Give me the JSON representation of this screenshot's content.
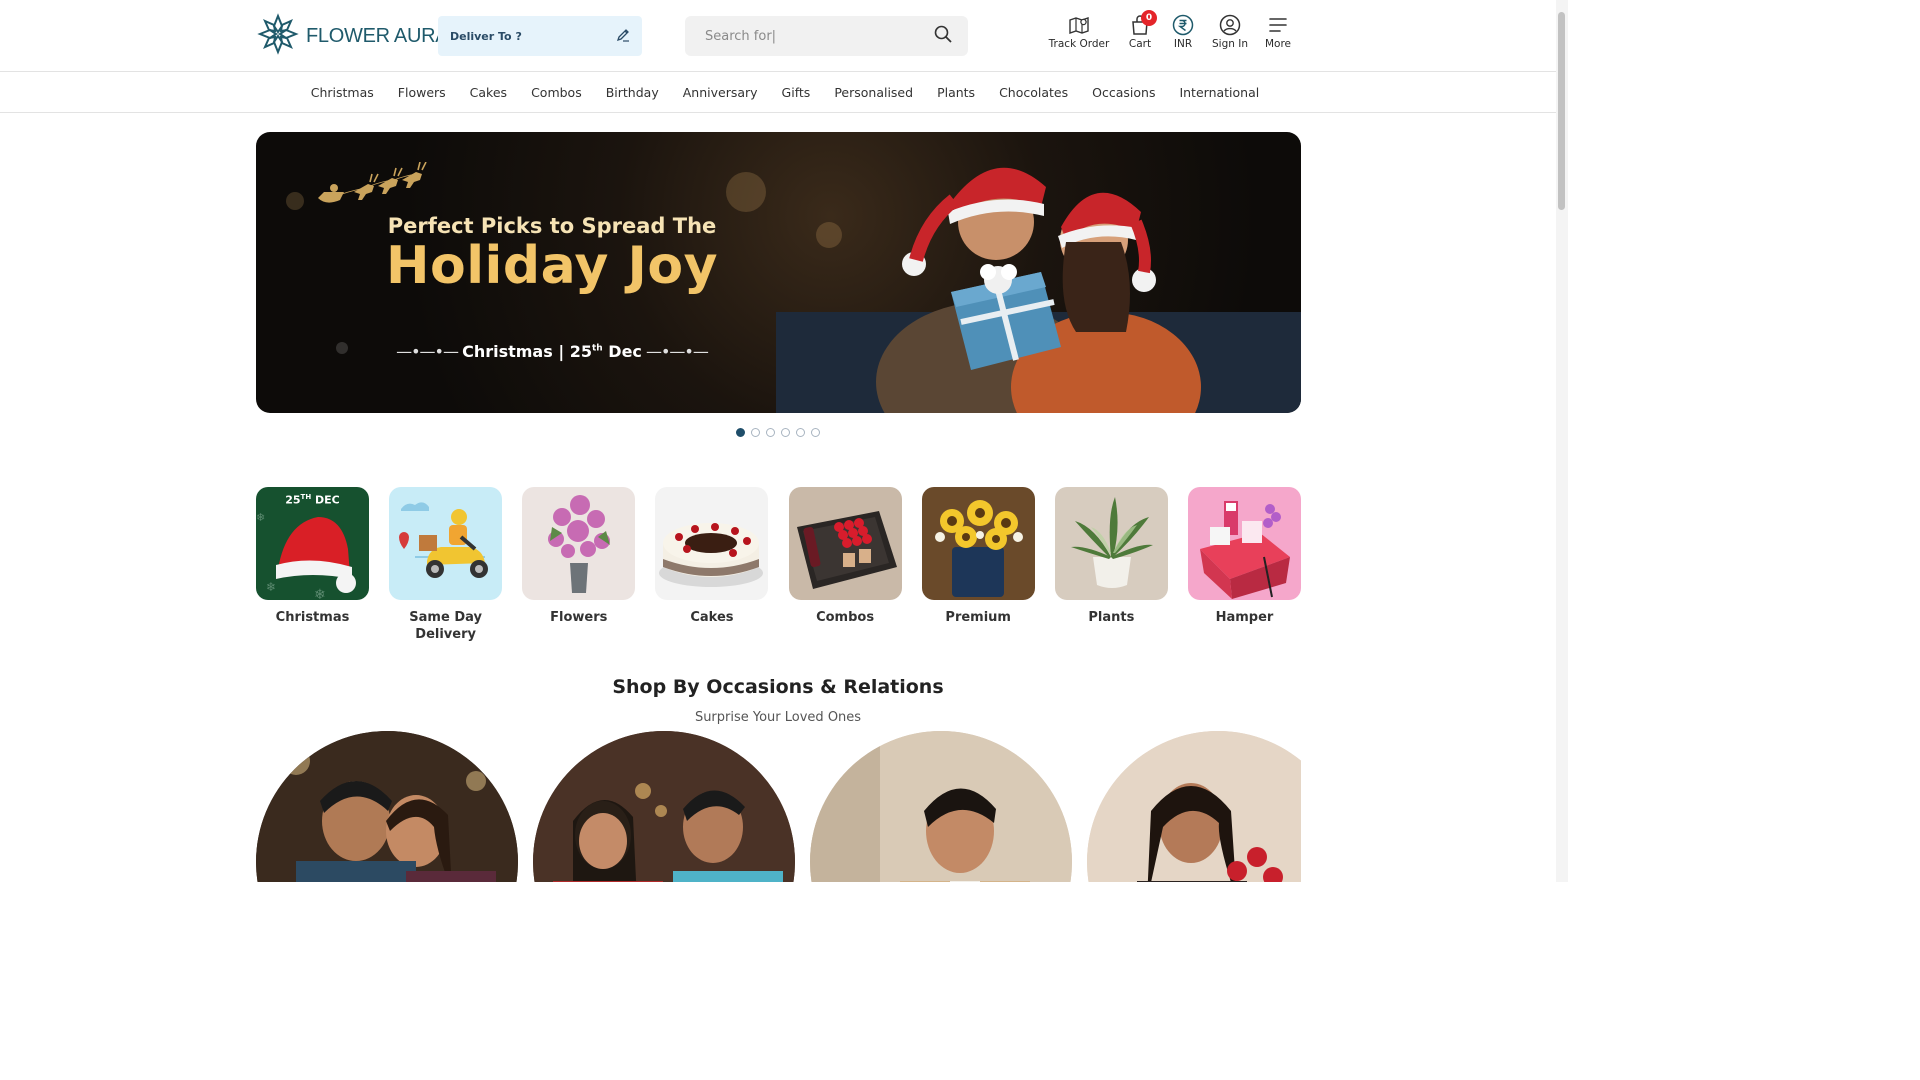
{
  "brand": {
    "name": "FLOWER AURA"
  },
  "header": {
    "deliver_label": "Deliver To ?",
    "search_placeholder": "Search for|",
    "actions": [
      {
        "label": "Track Order",
        "icon": "map-pin-icon"
      },
      {
        "label": "Cart",
        "icon": "bag-icon",
        "badge": "0"
      },
      {
        "label": "INR",
        "icon": "rupee-icon"
      },
      {
        "label": "Sign In",
        "icon": "user-icon"
      },
      {
        "label": "More",
        "icon": "menu-icon"
      }
    ]
  },
  "nav": [
    "Christmas",
    "Flowers",
    "Cakes",
    "Combos",
    "Birthday",
    "Anniversary",
    "Gifts",
    "Personalised",
    "Plants",
    "Chocolates",
    "Occasions",
    "International"
  ],
  "banner": {
    "subtitle": "Perfect Picks to Spread The",
    "title": "Holiday Joy",
    "date_prefix": "Christmas | 25",
    "date_sup": "th",
    "date_suffix": " Dec",
    "slides_total": 6,
    "active_slide": 1
  },
  "categories": [
    {
      "name": "Christmas",
      "badge": "25",
      "badge_sup": "TH",
      "badge_suffix": " DEC"
    },
    {
      "name": "Same Day Delivery"
    },
    {
      "name": "Flowers"
    },
    {
      "name": "Cakes"
    },
    {
      "name": "Combos"
    },
    {
      "name": "Premium"
    },
    {
      "name": "Plants"
    },
    {
      "name": "Hamper"
    }
  ],
  "occasions": {
    "title": "Shop By Occasions & Relations",
    "subtitle": "Surprise Your Loved Ones"
  },
  "colors": {
    "brand": "#1f5a6b",
    "accent_gold": "#f2c468",
    "badge_red": "#e4252a",
    "deliver_bg": "#e6f3fb"
  }
}
